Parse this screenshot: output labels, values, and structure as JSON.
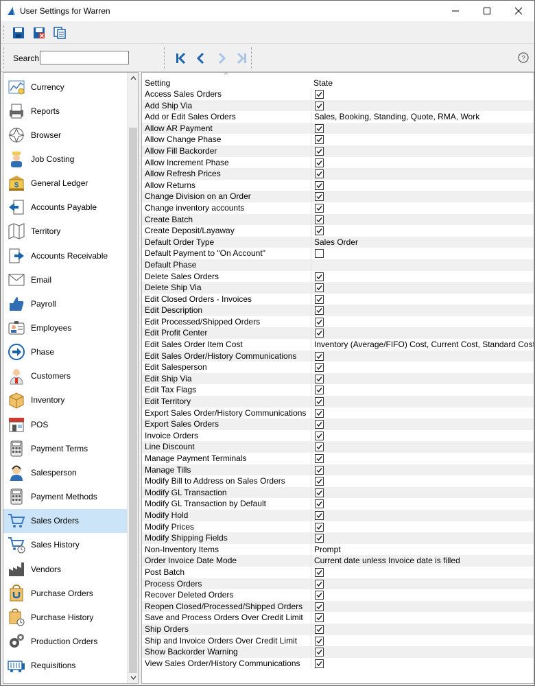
{
  "window": {
    "title": "User Settings for Warren"
  },
  "search": {
    "label": "Search",
    "value": ""
  },
  "modules": [
    {
      "label": "Currency",
      "icon": "currency-icon"
    },
    {
      "label": "Reports",
      "icon": "reports-icon"
    },
    {
      "label": "Browser",
      "icon": "browser-icon"
    },
    {
      "label": "Job Costing",
      "icon": "job-costing-icon"
    },
    {
      "label": "General Ledger",
      "icon": "general-ledger-icon"
    },
    {
      "label": "Accounts Payable",
      "icon": "accounts-payable-icon"
    },
    {
      "label": "Territory",
      "icon": "territory-icon"
    },
    {
      "label": "Accounts Receivable",
      "icon": "accounts-receivable-icon"
    },
    {
      "label": "Email",
      "icon": "email-icon"
    },
    {
      "label": "Payroll",
      "icon": "payroll-icon"
    },
    {
      "label": "Employees",
      "icon": "employees-icon"
    },
    {
      "label": "Phase",
      "icon": "phase-icon"
    },
    {
      "label": "Customers",
      "icon": "customers-icon"
    },
    {
      "label": "Inventory",
      "icon": "inventory-icon"
    },
    {
      "label": "POS",
      "icon": "pos-icon"
    },
    {
      "label": "Payment Terms",
      "icon": "payment-terms-icon"
    },
    {
      "label": "Salesperson",
      "icon": "salesperson-icon"
    },
    {
      "label": "Payment Methods",
      "icon": "payment-methods-icon"
    },
    {
      "label": "Sales Orders",
      "icon": "sales-orders-icon",
      "selected": true
    },
    {
      "label": "Sales History",
      "icon": "sales-history-icon"
    },
    {
      "label": "Vendors",
      "icon": "vendors-icon"
    },
    {
      "label": "Purchase Orders",
      "icon": "purchase-orders-icon"
    },
    {
      "label": "Purchase History",
      "icon": "purchase-history-icon"
    },
    {
      "label": "Production Orders",
      "icon": "production-orders-icon"
    },
    {
      "label": "Requisitions",
      "icon": "requisitions-icon"
    }
  ],
  "grid": {
    "columns": [
      "Setting",
      "State"
    ],
    "rows": [
      {
        "setting": "Access Sales Orders",
        "state": {
          "type": "check",
          "checked": true
        }
      },
      {
        "setting": "Add Ship Via",
        "state": {
          "type": "check",
          "checked": true
        }
      },
      {
        "setting": "Add or Edit Sales Orders",
        "state": {
          "type": "text",
          "value": "Sales, Booking, Standing, Quote, RMA, Work"
        }
      },
      {
        "setting": "Allow AR Payment",
        "state": {
          "type": "check",
          "checked": true
        }
      },
      {
        "setting": "Allow Change Phase",
        "state": {
          "type": "check",
          "checked": true
        }
      },
      {
        "setting": "Allow Fill Backorder",
        "state": {
          "type": "check",
          "checked": true
        }
      },
      {
        "setting": "Allow Increment Phase",
        "state": {
          "type": "check",
          "checked": true
        }
      },
      {
        "setting": "Allow Refresh Prices",
        "state": {
          "type": "check",
          "checked": true
        }
      },
      {
        "setting": "Allow Returns",
        "state": {
          "type": "check",
          "checked": true
        }
      },
      {
        "setting": "Change Division on an Order",
        "state": {
          "type": "check",
          "checked": true
        }
      },
      {
        "setting": "Change inventory accounts",
        "state": {
          "type": "check",
          "checked": true
        }
      },
      {
        "setting": "Create Batch",
        "state": {
          "type": "check",
          "checked": true
        }
      },
      {
        "setting": "Create Deposit/Layaway",
        "state": {
          "type": "check",
          "checked": true
        }
      },
      {
        "setting": "Default Order Type",
        "state": {
          "type": "text",
          "value": "Sales Order"
        }
      },
      {
        "setting": "Default Payment to \"On Account\"",
        "state": {
          "type": "check",
          "checked": false
        }
      },
      {
        "setting": "Default Phase",
        "state": {
          "type": "text",
          "value": ""
        }
      },
      {
        "setting": "Delete Sales Orders",
        "state": {
          "type": "check",
          "checked": true
        }
      },
      {
        "setting": "Delete Ship Via",
        "state": {
          "type": "check",
          "checked": true
        }
      },
      {
        "setting": "Edit Closed Orders - Invoices",
        "state": {
          "type": "check",
          "checked": true
        }
      },
      {
        "setting": "Edit Description",
        "state": {
          "type": "check",
          "checked": true
        }
      },
      {
        "setting": "Edit Processed/Shipped Orders",
        "state": {
          "type": "check",
          "checked": true
        }
      },
      {
        "setting": "Edit Profit Center",
        "state": {
          "type": "check",
          "checked": true
        }
      },
      {
        "setting": "Edit Sales Order Item Cost",
        "state": {
          "type": "text",
          "value": "Inventory (Average/FIFO) Cost, Current Cost, Standard Cost"
        }
      },
      {
        "setting": "Edit Sales Order/History Communications",
        "state": {
          "type": "check",
          "checked": true
        }
      },
      {
        "setting": "Edit Salesperson",
        "state": {
          "type": "check",
          "checked": true
        }
      },
      {
        "setting": "Edit Ship Via",
        "state": {
          "type": "check",
          "checked": true
        }
      },
      {
        "setting": "Edit Tax Flags",
        "state": {
          "type": "check",
          "checked": true
        }
      },
      {
        "setting": "Edit Territory",
        "state": {
          "type": "check",
          "checked": true
        }
      },
      {
        "setting": "Export Sales Order/History Communications",
        "state": {
          "type": "check",
          "checked": true
        }
      },
      {
        "setting": "Export Sales Orders",
        "state": {
          "type": "check",
          "checked": true
        }
      },
      {
        "setting": "Invoice Orders",
        "state": {
          "type": "check",
          "checked": true
        }
      },
      {
        "setting": "Line Discount",
        "state": {
          "type": "check",
          "checked": true
        }
      },
      {
        "setting": "Manage Payment Terminals",
        "state": {
          "type": "check",
          "checked": true
        }
      },
      {
        "setting": "Manage Tills",
        "state": {
          "type": "check",
          "checked": true
        }
      },
      {
        "setting": "Modify Bill to Address on Sales Orders",
        "state": {
          "type": "check",
          "checked": true
        }
      },
      {
        "setting": "Modify GL Transaction",
        "state": {
          "type": "check",
          "checked": true
        }
      },
      {
        "setting": "Modify GL Transaction by Default",
        "state": {
          "type": "check",
          "checked": true
        }
      },
      {
        "setting": "Modify Hold",
        "state": {
          "type": "check",
          "checked": true
        }
      },
      {
        "setting": "Modify Prices",
        "state": {
          "type": "check",
          "checked": true
        }
      },
      {
        "setting": "Modify Shipping Fields",
        "state": {
          "type": "check",
          "checked": true
        }
      },
      {
        "setting": "Non-Inventory Items",
        "state": {
          "type": "text",
          "value": "Prompt"
        }
      },
      {
        "setting": "Order Invoice Date Mode",
        "state": {
          "type": "text",
          "value": "Current date unless Invoice date is filled"
        }
      },
      {
        "setting": "Post Batch",
        "state": {
          "type": "check",
          "checked": true
        }
      },
      {
        "setting": "Process Orders",
        "state": {
          "type": "check",
          "checked": true
        }
      },
      {
        "setting": "Recover Deleted Orders",
        "state": {
          "type": "check",
          "checked": true
        }
      },
      {
        "setting": "Reopen Closed/Processed/Shipped Orders",
        "state": {
          "type": "check",
          "checked": true
        }
      },
      {
        "setting": "Save and Process Orders Over Credit Limit",
        "state": {
          "type": "check",
          "checked": true
        }
      },
      {
        "setting": "Ship Orders",
        "state": {
          "type": "check",
          "checked": true
        }
      },
      {
        "setting": "Ship and Invoice Orders Over Credit Limit",
        "state": {
          "type": "check",
          "checked": true
        }
      },
      {
        "setting": "Show Backorder Warning",
        "state": {
          "type": "check",
          "checked": true
        }
      },
      {
        "setting": "View Sales Order/History Communications",
        "state": {
          "type": "check",
          "checked": true
        }
      }
    ]
  },
  "colors": {
    "accent": "#1a63ad",
    "selected_row": "#cce4f7",
    "alt_row": "#f0f0f0"
  }
}
